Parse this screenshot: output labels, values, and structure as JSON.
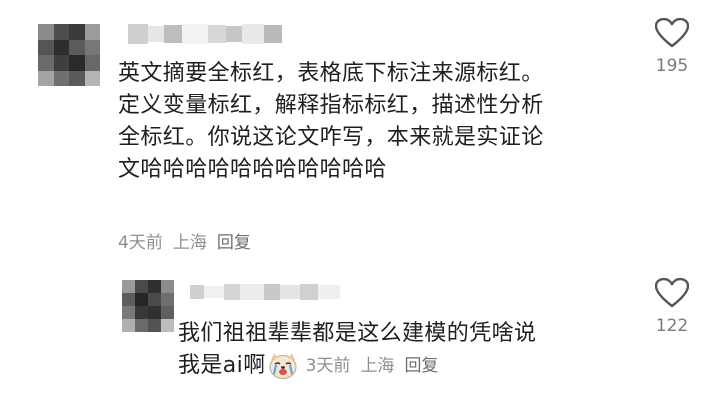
{
  "comments": [
    {
      "text_lines": [
        "英文摘要全标红，表格底下标注来源标红。",
        "定义变量标红，解释指标标红，描述性分析",
        "全标红。你说这论文咋写，本来就是实证论",
        "文哈哈哈哈哈哈哈哈哈哈哈"
      ],
      "time": "4天前",
      "location": "上海",
      "reply_label": "回复",
      "like_count": "195",
      "like_icon": "heart-outline-icon"
    },
    {
      "text_lines": [
        "我们祖祖辈辈都是这么建模的凭啥说",
        "我是ai啊"
      ],
      "emoji": "crying-dog-emoji",
      "time": "3天前",
      "location": "上海",
      "reply_label": "回复",
      "like_count": "122",
      "like_icon": "heart-outline-icon"
    }
  ],
  "colors": {
    "text": "#1f1f1f",
    "meta": "#8f8f8f",
    "icon": "#555555"
  }
}
